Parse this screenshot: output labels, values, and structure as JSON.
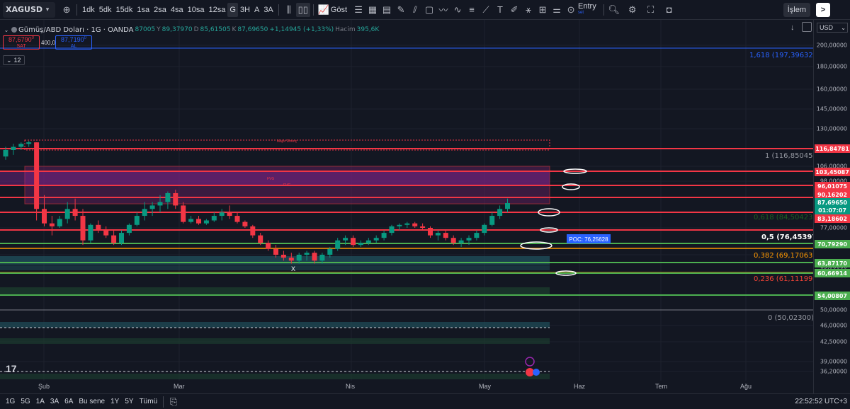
{
  "toolbar": {
    "symbol": "XAGUSD",
    "timeframes": [
      "1dk",
      "5dk",
      "15dk",
      "1sa",
      "2sa",
      "4sa",
      "10sa",
      "12sa",
      "G",
      "3H",
      "A",
      "3A"
    ],
    "active_timeframe": "G",
    "indicators_label": "Göst",
    "entry_label": "Entry",
    "entry_sub": "set",
    "trade_button": "İşlem"
  },
  "legend": {
    "name": "Gümüş/ABD Doları · 1G · OANDA",
    "open": "87005",
    "high_label": "Y",
    "high": "89,37970",
    "low_label": "D",
    "low": "85,61505",
    "close_label": "K",
    "close": "87,69650",
    "change": "+1,14945 (+1,33%)",
    "volume_label": "Hacim",
    "volume": "395,6K",
    "sell_price": "87,6790",
    "sell_sup": "0",
    "sell_label": "SAT",
    "spread": "400,0",
    "buy_price": "87,7190",
    "buy_sup": "0",
    "buy_label": "AL",
    "indicator_count": "12"
  },
  "price_axis": {
    "currency": "USD",
    "ticks": [
      "200,00000",
      "180,00000",
      "160,00000",
      "145,00000",
      "130,00000",
      "106,00000",
      "98,00000",
      "77,00000",
      "65,00000",
      "59,00000",
      "50,00000",
      "46,00000",
      "42,50000",
      "39,00000",
      "36,20000"
    ],
    "badges": [
      {
        "text": "116,84781",
        "color": "#f23645"
      },
      {
        "text": "103,45087",
        "color": "#f23645"
      },
      {
        "text": "96,01075",
        "color": "#f23645"
      },
      {
        "text": "90,16202",
        "color": "#f23645"
      },
      {
        "text": "87,69650",
        "color": "#089981"
      },
      {
        "text": "01:07:07",
        "color": "#089981"
      },
      {
        "text": "83,18602",
        "color": "#f23645"
      },
      {
        "text": "70,79290",
        "color": "#4caf50"
      },
      {
        "text": "63,87170",
        "color": "#4caf50"
      },
      {
        "text": "60,66914",
        "color": "#4caf50"
      },
      {
        "text": "54,00807",
        "color": "#4caf50"
      }
    ]
  },
  "fib_levels": [
    {
      "text": "1,618 (197,39632)",
      "color": "#2962ff"
    },
    {
      "text": "1 (116,85045)",
      "color": "#9598a1"
    },
    {
      "text": "0,618 (84,50423)",
      "color": "#1b5e20"
    },
    {
      "text": "0,5 (76,45397)",
      "color": "#ffffff"
    },
    {
      "text": "0,382 (69,17063)",
      "color": "#ff9800"
    },
    {
      "text": "0,236 (61,11199)",
      "color": "#f44336"
    },
    {
      "text": "0 (50,02300)",
      "color": "#9598a1"
    }
  ],
  "annotations": {
    "poc": "POC: 76,25628",
    "x_marker": "X",
    "major_label": "Majör Direnç",
    "fvg1": "FVG",
    "fvg2": "FVG"
  },
  "time_axis": [
    "Şub",
    "Mar",
    "Nis",
    "May",
    "Haz",
    "Tem",
    "Ağu"
  ],
  "bottom_bar": {
    "ranges": [
      "1G",
      "5G",
      "1A",
      "3A",
      "6A",
      "Bu sene",
      "1Y",
      "5Y",
      "Tümü"
    ],
    "clock": "22:52:52 UTC+3"
  },
  "chart_data": {
    "type": "candlestick",
    "candles": [
      [
        112,
        118,
        110,
        116
      ],
      [
        116,
        120,
        113,
        118
      ],
      [
        118,
        121,
        116,
        120
      ],
      [
        120,
        122,
        118,
        121
      ],
      [
        121,
        121,
        82,
        86
      ],
      [
        86,
        90,
        78,
        80
      ],
      [
        80,
        84,
        74,
        78
      ],
      [
        78,
        84,
        77,
        83
      ],
      [
        83,
        88,
        80,
        86
      ],
      [
        86,
        89,
        82,
        84
      ],
      [
        84,
        86,
        70,
        72
      ],
      [
        72,
        80,
        71,
        79
      ],
      [
        79,
        82,
        75,
        76
      ],
      [
        76,
        78,
        73,
        74
      ],
      [
        74,
        76,
        70,
        71
      ],
      [
        71,
        76,
        70,
        75
      ],
      [
        75,
        80,
        74,
        79
      ],
      [
        79,
        85,
        78,
        84
      ],
      [
        84,
        88,
        82,
        86
      ],
      [
        86,
        88,
        84,
        87
      ],
      [
        87,
        90,
        85,
        88
      ],
      [
        88,
        92,
        86,
        91
      ],
      [
        91,
        93,
        86,
        87
      ],
      [
        87,
        88,
        80,
        81
      ],
      [
        81,
        84,
        80,
        83
      ],
      [
        83,
        84,
        79,
        80
      ],
      [
        80,
        83,
        79,
        82
      ],
      [
        82,
        85,
        81,
        84
      ],
      [
        84,
        86,
        82,
        85
      ],
      [
        85,
        87,
        83,
        84
      ],
      [
        84,
        85,
        80,
        81
      ],
      [
        81,
        82,
        77,
        78
      ],
      [
        78,
        79,
        73,
        74
      ],
      [
        74,
        75,
        70,
        71
      ],
      [
        71,
        72,
        67,
        68
      ],
      [
        68,
        70,
        64,
        65
      ],
      [
        65,
        67,
        63,
        64
      ],
      [
        64,
        66,
        62,
        63
      ],
      [
        63,
        66,
        62,
        65
      ],
      [
        65,
        67,
        63,
        66
      ],
      [
        66,
        67,
        62,
        63
      ],
      [
        63,
        66,
        62,
        65
      ],
      [
        65,
        69,
        64,
        68
      ],
      [
        68,
        73,
        67,
        72
      ],
      [
        72,
        74,
        70,
        73
      ],
      [
        73,
        74,
        69,
        70
      ],
      [
        70,
        72,
        69,
        71
      ],
      [
        71,
        73,
        70,
        72
      ],
      [
        72,
        74,
        71,
        73
      ],
      [
        73,
        76,
        72,
        75
      ],
      [
        75,
        79,
        74,
        78
      ],
      [
        78,
        80,
        76,
        79
      ],
      [
        79,
        81,
        77,
        80
      ],
      [
        80,
        81,
        77,
        78
      ],
      [
        78,
        80,
        76,
        77
      ],
      [
        77,
        78,
        73,
        74
      ],
      [
        74,
        76,
        72,
        75
      ],
      [
        75,
        76,
        72,
        73
      ],
      [
        73,
        74,
        70,
        71
      ],
      [
        71,
        73,
        69,
        72
      ],
      [
        72,
        74,
        70,
        73
      ],
      [
        73,
        76,
        72,
        75
      ],
      [
        75,
        80,
        74,
        79
      ],
      [
        79,
        85,
        78,
        84
      ],
      [
        84,
        87,
        83,
        86
      ],
      [
        86,
        89,
        85,
        87.7
      ]
    ]
  }
}
